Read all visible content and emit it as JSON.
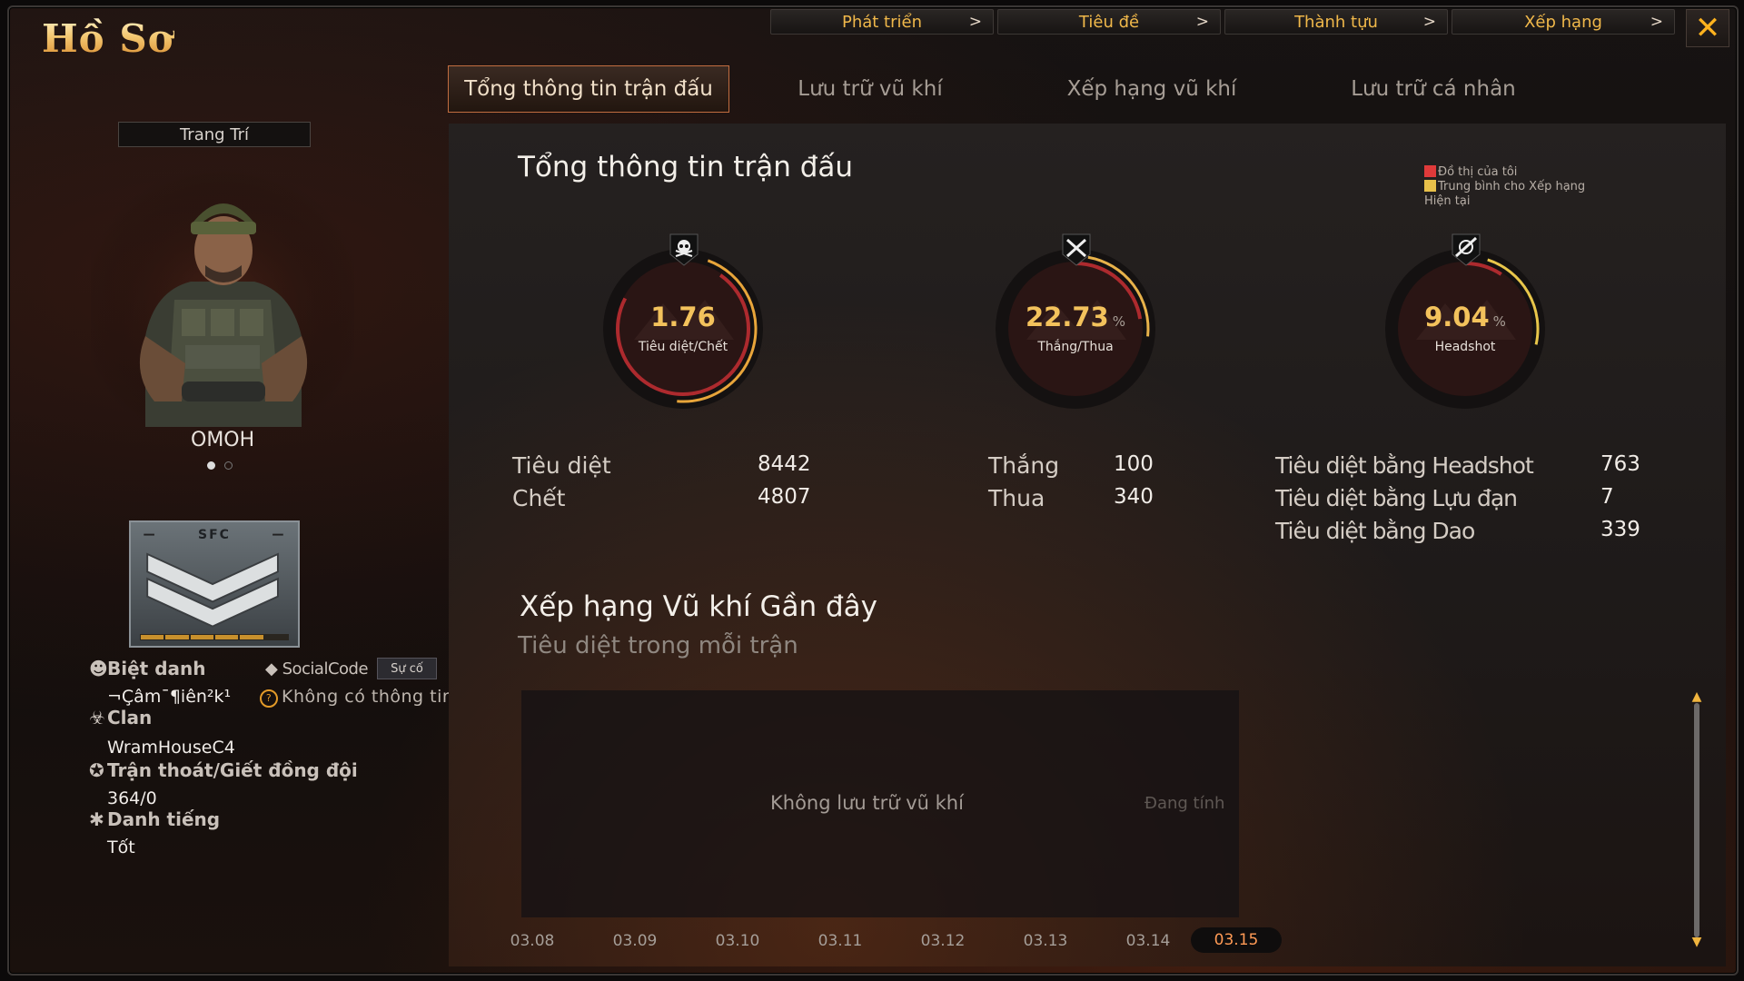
{
  "header": {
    "title": "Hồ Sơ"
  },
  "topbar": [
    {
      "label": "Phát triển",
      "chevron": ">"
    },
    {
      "label": "Tiêu đề",
      "chevron": ">"
    },
    {
      "label": "Thành tựu",
      "chevron": ">"
    },
    {
      "label": "Xếp hạng",
      "chevron": ">"
    }
  ],
  "close_label": "✕",
  "tabs": [
    {
      "label": "Tổng thông tin trận đấu",
      "active": true
    },
    {
      "label": "Lưu trữ vũ khí"
    },
    {
      "label": "Xếp hạng vũ khí"
    },
    {
      "label": "Lưu trữ cá nhân"
    }
  ],
  "profile": {
    "decorate_label": "Trang Trí",
    "character_name": "OMOH",
    "rank_text": "SFC",
    "nickname_label": "Biệt danh",
    "nickname_value": "¬Çâm¯¶iên²k¹",
    "socialcode_label": "SocialCode",
    "suco_label": "Sự cố",
    "no_info": "Không có thông tin",
    "clan_label": "Clan",
    "clan_value": "WramHouseC4",
    "escape_label": "Trận thoát/Giết đồng đội",
    "escape_value": "364/0",
    "reputation_label": "Danh tiếng",
    "reputation_value": "Tốt"
  },
  "summary": {
    "title": "Tổng thông tin trận đấu",
    "legend_mine": "Đồ thị của tôi",
    "legend_avg": "Trung bình cho Xếp hạng Hiện tại",
    "colors": {
      "mine": "#e03a3a",
      "avg": "#e8c04a"
    },
    "gauges": [
      {
        "value": "1.76",
        "unit": "",
        "label": "Tiêu diệt/Chết",
        "icon": "skull-icon"
      },
      {
        "value": "22.73",
        "unit": "%",
        "label": "Thắng/Thua",
        "icon": "crossed-swords-icon"
      },
      {
        "value": "9.04",
        "unit": "%",
        "label": "Headshot",
        "icon": "crosshair-icon"
      }
    ],
    "stats": {
      "kills_label": "Tiêu diệt",
      "kills": "8442",
      "deaths_label": "Chết",
      "deaths": "4807",
      "wins_label": "Thắng",
      "wins": "100",
      "losses_label": "Thua",
      "losses": "340",
      "hs_label": "Tiêu diệt bằng Headshot",
      "hs": "763",
      "grenade_label": "Tiêu diệt bằng Lựu đạn",
      "grenade": "7",
      "knife_label": "Tiêu diệt bằng Dao",
      "knife": "339"
    }
  },
  "recent": {
    "title": "Xếp hạng Vũ khí Gần đây",
    "subtitle": "Tiêu diệt trong mỗi trận",
    "empty_message": "Không lưu trữ vũ khí",
    "calculating": "Đang tính",
    "dates": [
      "03.08",
      "03.09",
      "03.10",
      "03.11",
      "03.12",
      "03.13",
      "03.14",
      "03.15"
    ],
    "active_date": "03.15"
  }
}
